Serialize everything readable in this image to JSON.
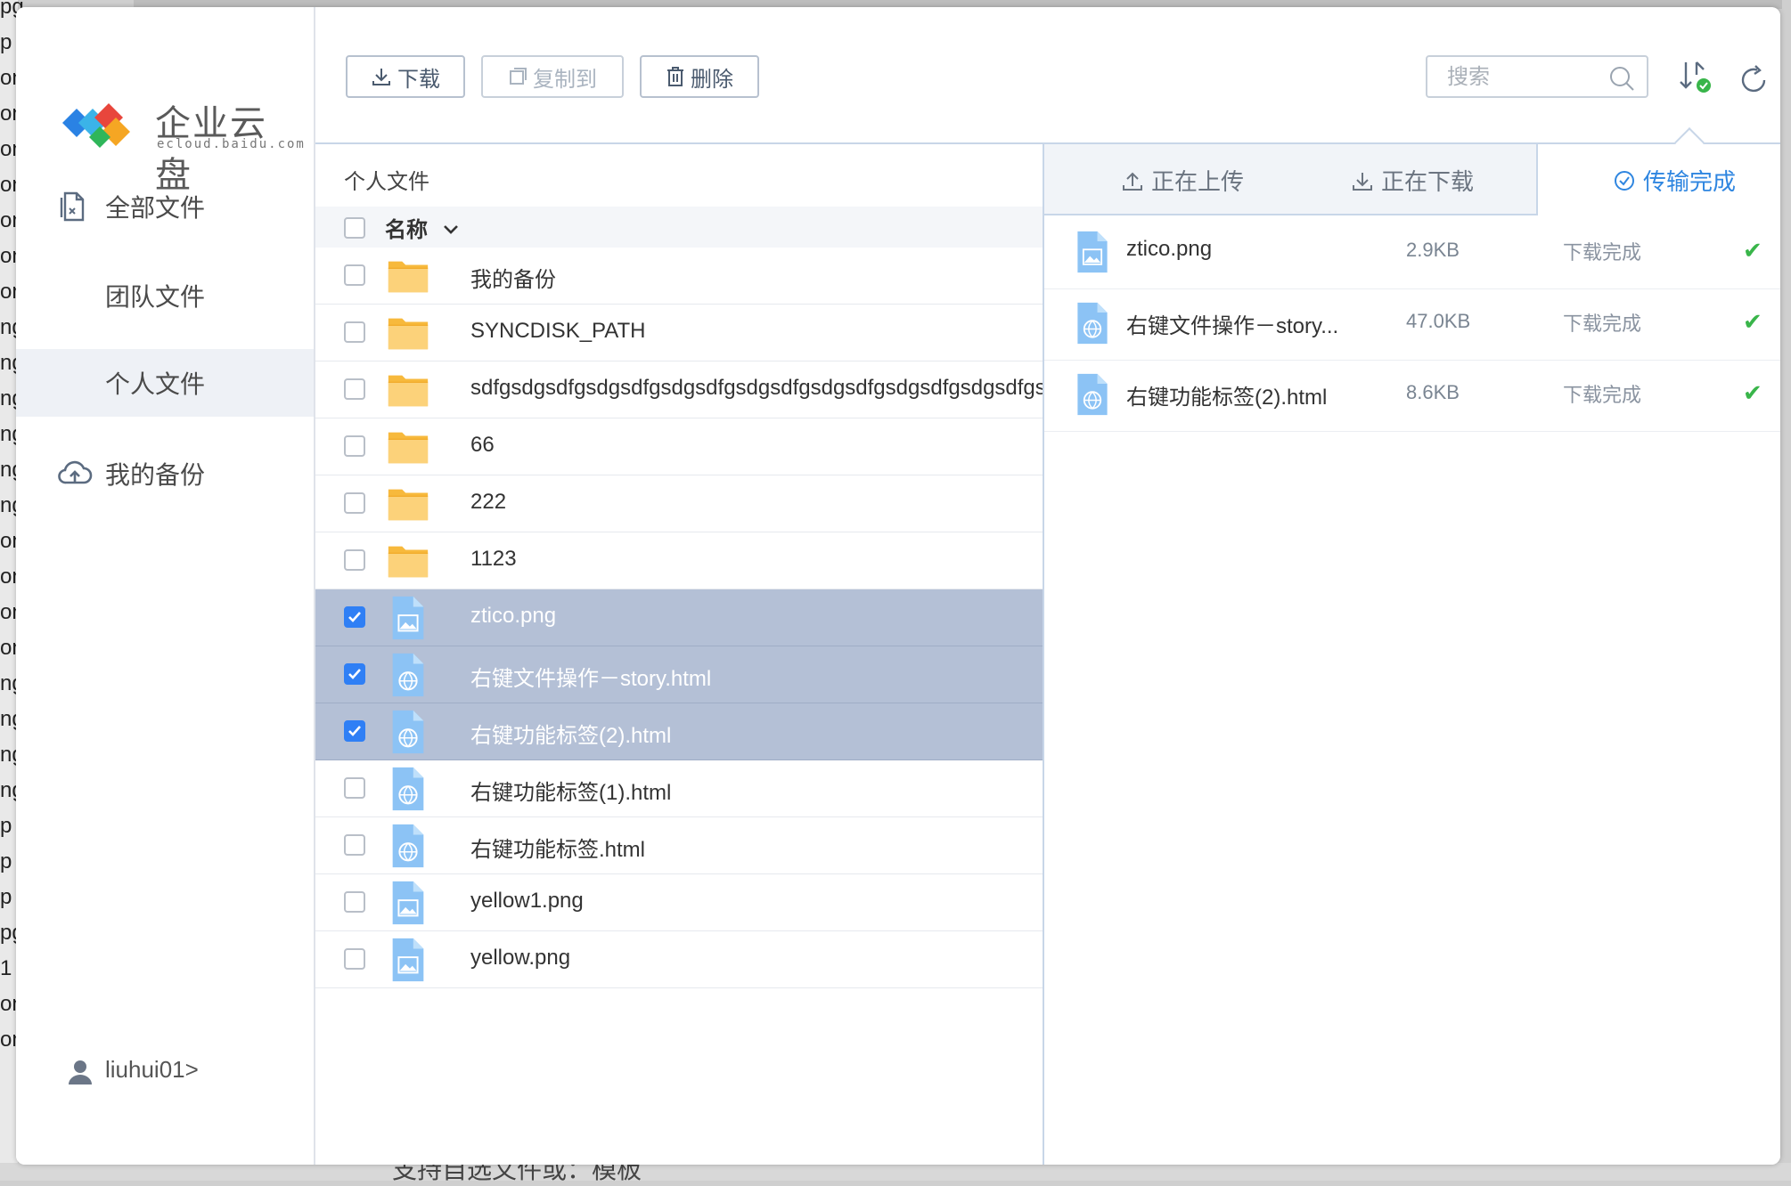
{
  "background": {
    "left_fragments": [
      "pg",
      "p",
      "on",
      "on",
      "on",
      "on",
      "on",
      "on",
      "on",
      "ng",
      "ng",
      "ng",
      "ng",
      "ng",
      "ng",
      "on",
      "on",
      "on",
      "on",
      "ng",
      "ng",
      "ng",
      "ng",
      "p",
      "p",
      "p",
      "pg",
      "1",
      "on",
      "on"
    ],
    "bottom_text": "支持自选文件或：模板"
  },
  "app": {
    "logo_text": "企业云盘",
    "logo_sub": "ecloud.baidu.com"
  },
  "sidebar": {
    "items": [
      {
        "label": "全部文件",
        "icon": "document-icon"
      },
      {
        "label": "团队文件",
        "icon": ""
      },
      {
        "label": "个人文件",
        "icon": "",
        "active": true
      },
      {
        "label": "我的备份",
        "icon": "cloud-upload-icon"
      }
    ],
    "user": "liuhui01>"
  },
  "toolbar": {
    "download_label": "下载",
    "copy_label": "复制到",
    "delete_label": "删除",
    "search_placeholder": "搜索"
  },
  "files": {
    "breadcrumb": "个人文件",
    "header_name": "名称",
    "rows": [
      {
        "name": "我的备份",
        "type": "folder",
        "selected": false
      },
      {
        "name": "SYNCDISK_PATH",
        "type": "folder",
        "selected": false
      },
      {
        "name": "sdfgsdgsdfgsdgsdfgsdgsdfgsdgsdfgsdgsdfgsdgsdfgsdgsdfgsdgsdfg",
        "type": "folder",
        "selected": false
      },
      {
        "name": "66",
        "type": "folder",
        "selected": false
      },
      {
        "name": "222",
        "type": "folder",
        "selected": false
      },
      {
        "name": "1123",
        "type": "folder",
        "selected": false
      },
      {
        "name": "ztico.png",
        "type": "image",
        "selected": true
      },
      {
        "name": "右键文件操作－story.html",
        "type": "html",
        "selected": true
      },
      {
        "name": "右键功能标签(2).html",
        "type": "html",
        "selected": true
      },
      {
        "name": "右键功能标签(1).html",
        "type": "html",
        "selected": false
      },
      {
        "name": "右键功能标签.html",
        "type": "html",
        "selected": false
      },
      {
        "name": "yellow1.png",
        "type": "image",
        "selected": false
      },
      {
        "name": "yellow.png",
        "type": "image",
        "selected": false
      }
    ]
  },
  "transfer": {
    "tabs": [
      {
        "label": "正在上传",
        "icon": "upload-icon"
      },
      {
        "label": "正在下载",
        "icon": "download-icon"
      },
      {
        "label": "传输完成",
        "icon": "check-circle-icon",
        "active": true
      }
    ],
    "rows": [
      {
        "name": "ztico.png",
        "type": "image",
        "size": "2.9KB",
        "status": "下载完成"
      },
      {
        "name": "右键文件操作－story...",
        "type": "html",
        "size": "47.0KB",
        "status": "下载完成"
      },
      {
        "name": "右键功能标签(2).html",
        "type": "html",
        "size": "8.6KB",
        "status": "下载完成"
      }
    ],
    "ok_mark": "✔"
  },
  "colors": {
    "accent": "#2f86e0",
    "selection": "#b4c0d6",
    "folder": "#f9c451",
    "file_icon": "#8cc3f5",
    "success": "#39b54a"
  }
}
